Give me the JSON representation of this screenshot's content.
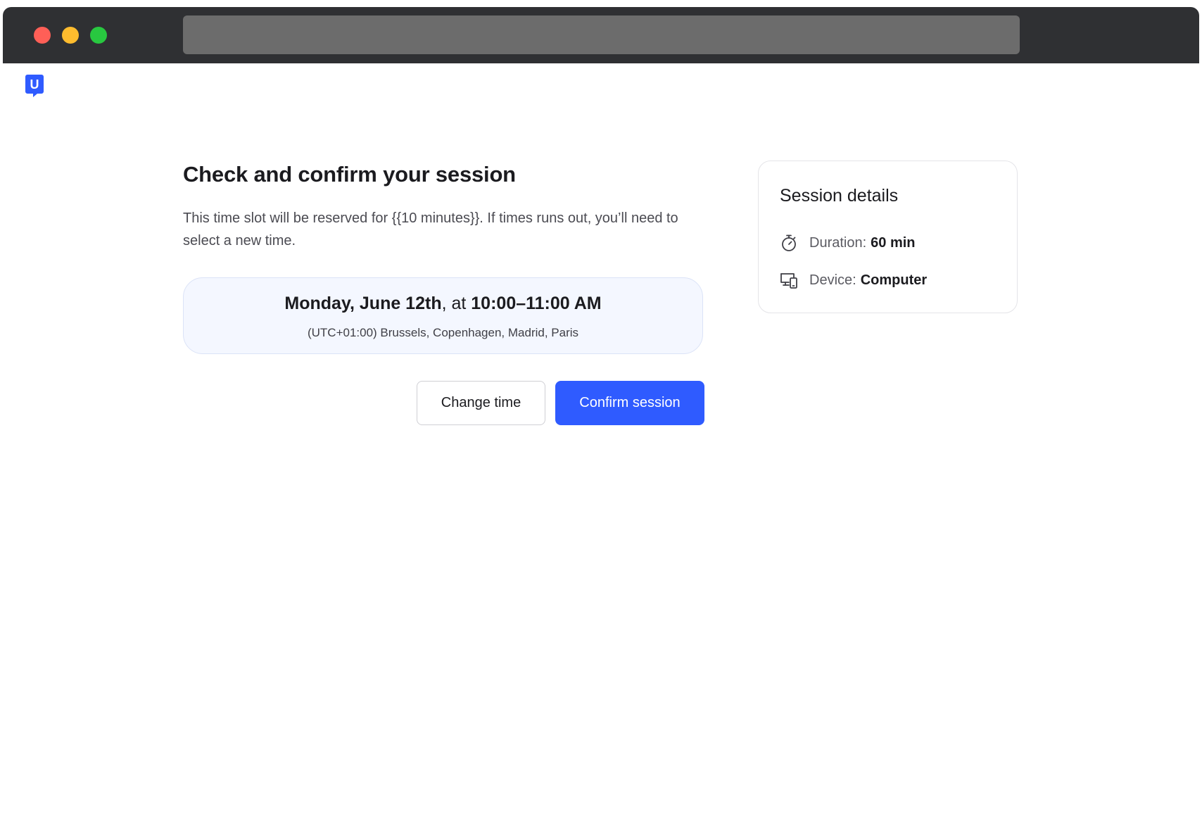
{
  "logo": {
    "letter": "U",
    "color": "#2f5bff"
  },
  "main": {
    "title": "Check and confirm your session",
    "intro": "This time slot will be reserved for {{10 minutes}}. If times runs out, you’ll need to select a new time.",
    "slot": {
      "date": "Monday, June 12th",
      "separator": ", at ",
      "time": "10:00–11:00 AM",
      "timezone": "(UTC+01:00) Brussels, Copenhagen, Madrid, Paris"
    },
    "actions": {
      "change_label": "Change time",
      "confirm_label": "Confirm session",
      "primary_color": "#2f5bff"
    }
  },
  "details": {
    "title": "Session details",
    "duration": {
      "icon": "stopwatch-icon",
      "label": "Duration:",
      "value": "60 min"
    },
    "device": {
      "icon": "devices-icon",
      "label": "Device:",
      "value": "Computer"
    }
  }
}
